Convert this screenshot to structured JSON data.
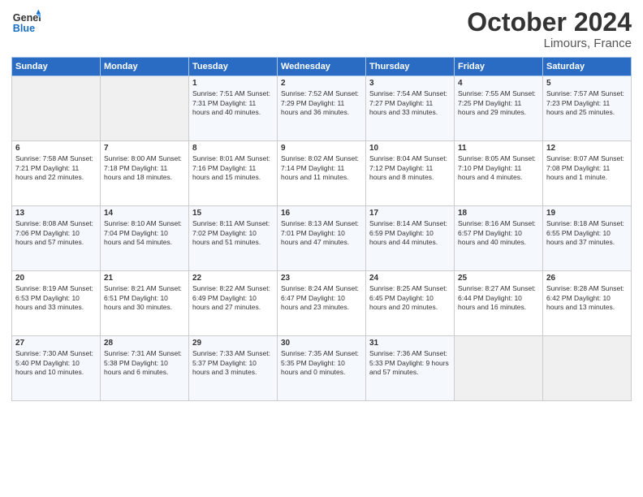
{
  "logo": {
    "line1": "General",
    "line2": "Blue"
  },
  "title": "October 2024",
  "location": "Limours, France",
  "days_of_week": [
    "Sunday",
    "Monday",
    "Tuesday",
    "Wednesday",
    "Thursday",
    "Friday",
    "Saturday"
  ],
  "weeks": [
    [
      {
        "day": "",
        "detail": ""
      },
      {
        "day": "",
        "detail": ""
      },
      {
        "day": "1",
        "detail": "Sunrise: 7:51 AM\nSunset: 7:31 PM\nDaylight: 11 hours\nand 40 minutes."
      },
      {
        "day": "2",
        "detail": "Sunrise: 7:52 AM\nSunset: 7:29 PM\nDaylight: 11 hours\nand 36 minutes."
      },
      {
        "day": "3",
        "detail": "Sunrise: 7:54 AM\nSunset: 7:27 PM\nDaylight: 11 hours\nand 33 minutes."
      },
      {
        "day": "4",
        "detail": "Sunrise: 7:55 AM\nSunset: 7:25 PM\nDaylight: 11 hours\nand 29 minutes."
      },
      {
        "day": "5",
        "detail": "Sunrise: 7:57 AM\nSunset: 7:23 PM\nDaylight: 11 hours\nand 25 minutes."
      }
    ],
    [
      {
        "day": "6",
        "detail": "Sunrise: 7:58 AM\nSunset: 7:21 PM\nDaylight: 11 hours\nand 22 minutes."
      },
      {
        "day": "7",
        "detail": "Sunrise: 8:00 AM\nSunset: 7:18 PM\nDaylight: 11 hours\nand 18 minutes."
      },
      {
        "day": "8",
        "detail": "Sunrise: 8:01 AM\nSunset: 7:16 PM\nDaylight: 11 hours\nand 15 minutes."
      },
      {
        "day": "9",
        "detail": "Sunrise: 8:02 AM\nSunset: 7:14 PM\nDaylight: 11 hours\nand 11 minutes."
      },
      {
        "day": "10",
        "detail": "Sunrise: 8:04 AM\nSunset: 7:12 PM\nDaylight: 11 hours\nand 8 minutes."
      },
      {
        "day": "11",
        "detail": "Sunrise: 8:05 AM\nSunset: 7:10 PM\nDaylight: 11 hours\nand 4 minutes."
      },
      {
        "day": "12",
        "detail": "Sunrise: 8:07 AM\nSunset: 7:08 PM\nDaylight: 11 hours\nand 1 minute."
      }
    ],
    [
      {
        "day": "13",
        "detail": "Sunrise: 8:08 AM\nSunset: 7:06 PM\nDaylight: 10 hours\nand 57 minutes."
      },
      {
        "day": "14",
        "detail": "Sunrise: 8:10 AM\nSunset: 7:04 PM\nDaylight: 10 hours\nand 54 minutes."
      },
      {
        "day": "15",
        "detail": "Sunrise: 8:11 AM\nSunset: 7:02 PM\nDaylight: 10 hours\nand 51 minutes."
      },
      {
        "day": "16",
        "detail": "Sunrise: 8:13 AM\nSunset: 7:01 PM\nDaylight: 10 hours\nand 47 minutes."
      },
      {
        "day": "17",
        "detail": "Sunrise: 8:14 AM\nSunset: 6:59 PM\nDaylight: 10 hours\nand 44 minutes."
      },
      {
        "day": "18",
        "detail": "Sunrise: 8:16 AM\nSunset: 6:57 PM\nDaylight: 10 hours\nand 40 minutes."
      },
      {
        "day": "19",
        "detail": "Sunrise: 8:18 AM\nSunset: 6:55 PM\nDaylight: 10 hours\nand 37 minutes."
      }
    ],
    [
      {
        "day": "20",
        "detail": "Sunrise: 8:19 AM\nSunset: 6:53 PM\nDaylight: 10 hours\nand 33 minutes."
      },
      {
        "day": "21",
        "detail": "Sunrise: 8:21 AM\nSunset: 6:51 PM\nDaylight: 10 hours\nand 30 minutes."
      },
      {
        "day": "22",
        "detail": "Sunrise: 8:22 AM\nSunset: 6:49 PM\nDaylight: 10 hours\nand 27 minutes."
      },
      {
        "day": "23",
        "detail": "Sunrise: 8:24 AM\nSunset: 6:47 PM\nDaylight: 10 hours\nand 23 minutes."
      },
      {
        "day": "24",
        "detail": "Sunrise: 8:25 AM\nSunset: 6:45 PM\nDaylight: 10 hours\nand 20 minutes."
      },
      {
        "day": "25",
        "detail": "Sunrise: 8:27 AM\nSunset: 6:44 PM\nDaylight: 10 hours\nand 16 minutes."
      },
      {
        "day": "26",
        "detail": "Sunrise: 8:28 AM\nSunset: 6:42 PM\nDaylight: 10 hours\nand 13 minutes."
      }
    ],
    [
      {
        "day": "27",
        "detail": "Sunrise: 7:30 AM\nSunset: 5:40 PM\nDaylight: 10 hours\nand 10 minutes."
      },
      {
        "day": "28",
        "detail": "Sunrise: 7:31 AM\nSunset: 5:38 PM\nDaylight: 10 hours\nand 6 minutes."
      },
      {
        "day": "29",
        "detail": "Sunrise: 7:33 AM\nSunset: 5:37 PM\nDaylight: 10 hours\nand 3 minutes."
      },
      {
        "day": "30",
        "detail": "Sunrise: 7:35 AM\nSunset: 5:35 PM\nDaylight: 10 hours\nand 0 minutes."
      },
      {
        "day": "31",
        "detail": "Sunrise: 7:36 AM\nSunset: 5:33 PM\nDaylight: 9 hours\nand 57 minutes."
      },
      {
        "day": "",
        "detail": ""
      },
      {
        "day": "",
        "detail": ""
      }
    ]
  ]
}
